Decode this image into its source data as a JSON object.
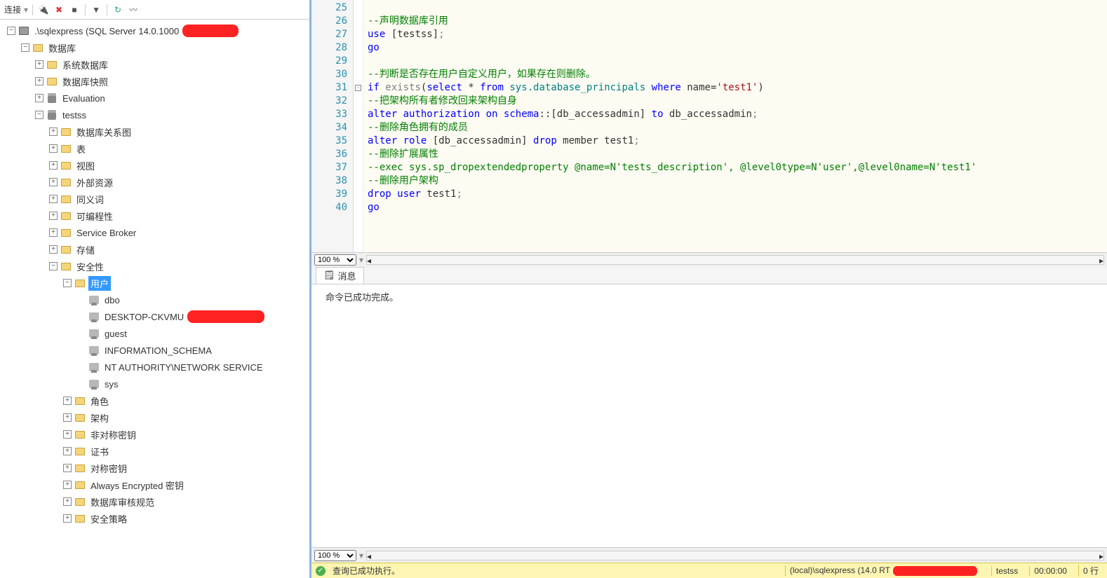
{
  "toolbar": {
    "connect_label": "连接"
  },
  "tree": {
    "server": ".\\sqlexpress (SQL Server 14.0.1000",
    "databases": "数据库",
    "sysdb": "系统数据库",
    "snapshots": "数据库快照",
    "evaluation": "Evaluation",
    "testss": "testss",
    "diagrams": "数据库关系图",
    "tables": "表",
    "views": "视图",
    "ext_resources": "外部资源",
    "synonyms": "同义词",
    "programmability": "可编程性",
    "service_broker": "Service Broker",
    "storage": "存储",
    "security": "安全性",
    "users": "用户",
    "user_dbo": "dbo",
    "user_desktop": "DESKTOP-CKVMU",
    "user_guest": "guest",
    "user_infoschema": "INFORMATION_SCHEMA",
    "user_nt": "NT AUTHORITY\\NETWORK SERVICE",
    "user_sys": "sys",
    "roles": "角色",
    "schemas": "架构",
    "asymkeys": "非对称密钥",
    "certs": "证书",
    "symkeys": "对称密钥",
    "ae_keys": "Always Encrypted 密钥",
    "audit_specs": "数据库审核规范",
    "sec_policies": "安全策略"
  },
  "code": {
    "line_start": 25,
    "lines": [
      {
        "t": "empty"
      },
      {
        "t": "com",
        "text": "--声明数据库引用"
      },
      {
        "t": "sql",
        "html": "<span class='kw'>use</span> [testss]<span class='op'>;</span>"
      },
      {
        "t": "sql",
        "html": "<span class='kw'>go</span>"
      },
      {
        "t": "empty"
      },
      {
        "t": "com",
        "text": "--判断是否存在用户自定义用户，如果存在则删除。"
      },
      {
        "t": "sql",
        "fold": "-",
        "html": "<span class='kw'>if</span> <span class='op'>exists</span>(<span class='kw'>select</span> * <span class='kw'>from</span> <span class='sys'>sys.database_principals</span> <span class='kw'>where</span> name=<span class='str'>'test1'</span>)"
      },
      {
        "t": "com",
        "text": "--把架构所有者修改回来架构自身"
      },
      {
        "t": "sql",
        "html": "<span class='kw'>alter</span> <span class='kw'>authorization</span> <span class='kw'>on</span> <span class='kw'>schema</span>::[db_accessadmin] <span class='kw'>to</span> db_accessadmin<span class='op'>;</span>"
      },
      {
        "t": "com",
        "text": "--删除角色拥有的成员"
      },
      {
        "t": "sql",
        "html": "<span class='kw'>alter</span> <span class='kw'>role</span> [db_accessadmin] <span class='kw'>drop</span> member test1<span class='op'>;</span>"
      },
      {
        "t": "com",
        "text": "--删除扩展属性"
      },
      {
        "t": "com",
        "text": "--exec sys.sp_dropextendedproperty @name=N'tests_description', @level0type=N'user',@level0name=N'test1'"
      },
      {
        "t": "com",
        "text": "--删除用户架构"
      },
      {
        "t": "sql",
        "html": "<span class='kw'>drop</span> <span class='kw'>user</span> test1<span class='op'>;</span>"
      },
      {
        "t": "sql",
        "html": "<span class='kw'>go</span>"
      }
    ]
  },
  "zoom_editor": "100 %",
  "zoom_results": "100 %",
  "messages": {
    "tab": "消息",
    "body": "命令已成功完成。"
  },
  "status": {
    "ok": "查询已成功执行。",
    "conn": "(local)\\sqlexpress (14.0 RT",
    "db": "testss",
    "time": "00:00:00",
    "rows": "0 行"
  }
}
